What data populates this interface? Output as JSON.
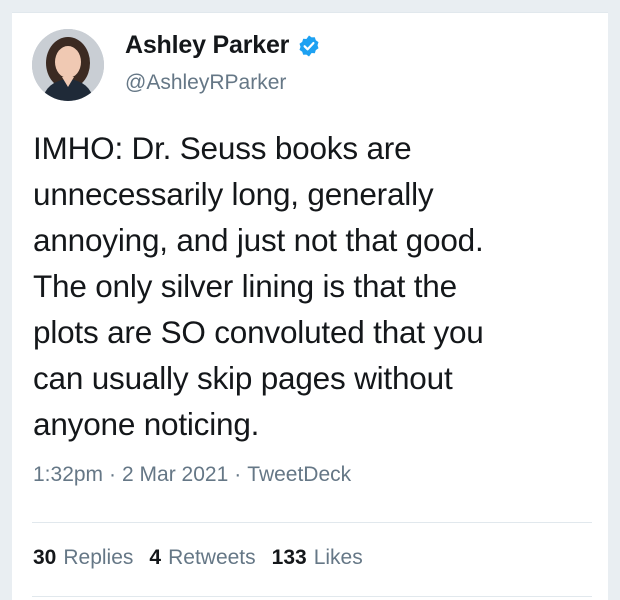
{
  "author": {
    "display_name": "Ashley Parker",
    "handle": "@AshleyRParker",
    "verified": true,
    "verified_color": "#1da1f2"
  },
  "tweet": {
    "text_lines": [
      "IMHO: Dr. Seuss books are",
      "unnecessarily long, generally",
      "annoying, and just not that good.",
      "The only silver lining is that the",
      "plots are SO convoluted that you",
      "can usually skip pages without",
      "anyone noticing."
    ],
    "time": "1:32pm",
    "date": "2 Mar 2021",
    "source": "TweetDeck",
    "separator": "·"
  },
  "stats": {
    "replies_count": "30",
    "replies_label": "Replies",
    "retweets_count": "4",
    "retweets_label": "Retweets",
    "likes_count": "133",
    "likes_label": "Likes"
  },
  "icons": {
    "avatar": "profile-photo",
    "verified": "verified-badge-icon"
  }
}
